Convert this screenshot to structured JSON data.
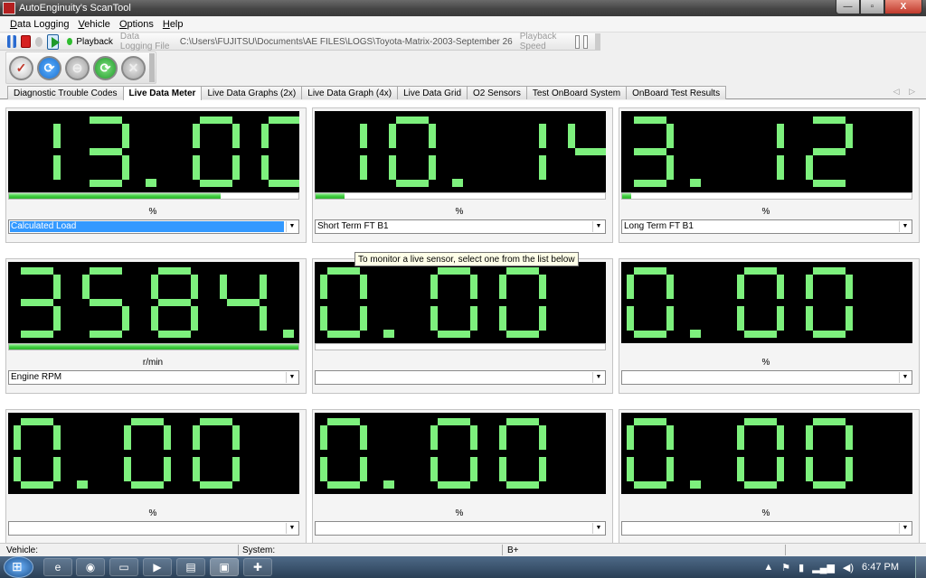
{
  "window": {
    "title": "AutoEnginuity's ScanTool",
    "controls": {
      "minimize": "—",
      "maximize": "▫",
      "close": "X"
    }
  },
  "menu": {
    "items": [
      {
        "label": "Data Logging",
        "accel": "D",
        "rest": "ata Logging"
      },
      {
        "label": "Vehicle",
        "accel": "V",
        "rest": "ehicle"
      },
      {
        "label": "Options",
        "accel": "O",
        "rest": "ptions"
      },
      {
        "label": "Help",
        "accel": "H",
        "rest": "elp"
      }
    ]
  },
  "playback_toolbar": {
    "playback_label": "Playback",
    "data_logging_file_label": "Data Logging File",
    "file_path": "C:\\Users\\FUJITSU\\Documents\\AE FILES\\LOGS\\Toyota-Matrix-2003-September 26",
    "playback_speed_label": "Playback Speed"
  },
  "icon_toolbar": {
    "buttons": [
      "check-icon",
      "refresh-icon",
      "disabled-icon",
      "go-icon",
      "cancel-icon"
    ]
  },
  "tabs": [
    {
      "label": "Diagnostic Trouble Codes",
      "active": false
    },
    {
      "label": "Live Data Meter",
      "active": true
    },
    {
      "label": "Live Data Graphs (2x)",
      "active": false
    },
    {
      "label": "Live Data Graph (4x)",
      "active": false
    },
    {
      "label": "Live Data Grid",
      "active": false
    },
    {
      "label": "O2 Sensors",
      "active": false
    },
    {
      "label": "Test OnBoard System",
      "active": false
    },
    {
      "label": "OnBoard Test Results",
      "active": false
    }
  ],
  "tab_scroll": "◁ ▷",
  "meters": [
    {
      "display": "13.00",
      "unit": "%",
      "sensor": "Calculated Load",
      "bar_fraction": 0.73,
      "selected": true
    },
    {
      "display": "10.14",
      "unit": "%",
      "sensor": "Short Term FT B1",
      "bar_fraction": 0.1,
      "selected": false
    },
    {
      "display": "3.12",
      "unit": "%",
      "sensor": "Long Term FT B1",
      "bar_fraction": 0.03,
      "selected": false
    },
    {
      "display": "3584.00",
      "unit": "r/min",
      "sensor": "Engine RPM",
      "bar_fraction": 1.0,
      "selected": false
    },
    {
      "display": "0.00",
      "unit": "",
      "sensor": "",
      "bar_fraction": 0,
      "selected": false
    },
    {
      "display": "0.00",
      "unit": "%",
      "sensor": "",
      "bar_fraction": null,
      "selected": false
    },
    {
      "display": "0.00",
      "unit": "%",
      "sensor": "",
      "bar_fraction": null,
      "selected": false
    },
    {
      "display": "0.00",
      "unit": "%",
      "sensor": "",
      "bar_fraction": null,
      "selected": false
    },
    {
      "display": "0.00",
      "unit": "%",
      "sensor": "",
      "bar_fraction": null,
      "selected": false
    }
  ],
  "tooltip": "To monitor a live sensor, select one from the list below",
  "statusbar": {
    "vehicle_label": "Vehicle:",
    "system_label": "System:",
    "battery_label": "B+"
  },
  "taskbar": {
    "apps": [
      "ie-icon",
      "chrome-icon",
      "folder-icon",
      "media-player-icon",
      "notepad-icon",
      "scantool-icon",
      "paint-icon"
    ],
    "clock": "6:47 PM",
    "tray_arrow": "▲"
  },
  "colors": {
    "segment_on": "#7df07d",
    "display_bg": "#000000",
    "selection": "#3399ff"
  }
}
